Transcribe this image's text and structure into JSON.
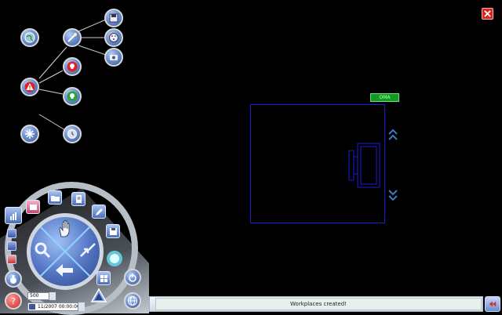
{
  "status": {
    "message": "Workplaces created!"
  },
  "workspace": {
    "badge_label": "OMA"
  },
  "controls": {
    "number_value": "500",
    "date_value": "11/2007 00:00:00"
  },
  "icons": {
    "tree_root": "warning-icon",
    "tree_nodes": [
      "world-icon",
      "magic-wand-icon",
      "save-icon",
      "palette-icon",
      "camera-icon",
      "skull-icon",
      "ok-skull-icon",
      "burst-icon",
      "clock-icon"
    ],
    "dial": [
      "hand-icon",
      "magnifier-icon",
      "arrows-icon",
      "back-arrow-icon"
    ]
  },
  "colors": {
    "workspace_border": "#1b1bd8",
    "badge": "#149a23",
    "accent": "#5779c6"
  }
}
